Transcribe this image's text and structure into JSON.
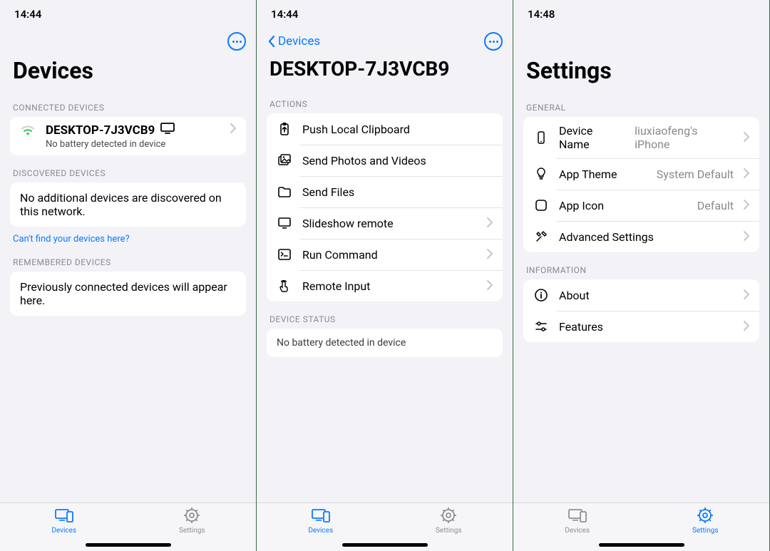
{
  "screen1": {
    "time": "14:44",
    "title": "Devices",
    "sections": {
      "connected_header": "CONNECTED DEVICES",
      "device_name": "DESKTOP-7J3VCB9",
      "device_sub": "No battery detected in device",
      "discovered_header": "DISCOVERED DEVICES",
      "discovered_text": "No additional devices are discovered on this network.",
      "discovered_link": "Can't find your devices here?",
      "remembered_header": "REMEMBERED DEVICES",
      "remembered_text": "Previously connected devices will appear here."
    },
    "tabs": {
      "devices": "Devices",
      "settings": "Settings",
      "active": "devices"
    }
  },
  "screen2": {
    "time": "14:44",
    "back_label": "Devices",
    "title": "DESKTOP-7J3VCB9",
    "actions_header": "ACTIONS",
    "actions": [
      {
        "id": "push-clipboard",
        "label": "Push Local Clipboard",
        "chevron": false
      },
      {
        "id": "send-photos",
        "label": "Send Photos and Videos",
        "chevron": false
      },
      {
        "id": "send-files",
        "label": "Send Files",
        "chevron": false
      },
      {
        "id": "slideshow-remote",
        "label": "Slideshow remote",
        "chevron": true
      },
      {
        "id": "run-command",
        "label": "Run Command",
        "chevron": true
      },
      {
        "id": "remote-input",
        "label": "Remote Input",
        "chevron": true
      }
    ],
    "status_header": "DEVICE STATUS",
    "status_text": "No battery detected in device",
    "tabs": {
      "devices": "Devices",
      "settings": "Settings",
      "active": "devices"
    }
  },
  "screen3": {
    "time": "14:48",
    "title": "Settings",
    "general_header": "GENERAL",
    "general": [
      {
        "id": "device-name",
        "label": "Device Name",
        "detail": "liuxiaofeng's iPhone"
      },
      {
        "id": "app-theme",
        "label": "App Theme",
        "detail": "System Default"
      },
      {
        "id": "app-icon",
        "label": "App Icon",
        "detail": "Default"
      },
      {
        "id": "advanced",
        "label": "Advanced Settings",
        "detail": ""
      }
    ],
    "info_header": "INFORMATION",
    "info": [
      {
        "id": "about",
        "label": "About"
      },
      {
        "id": "features",
        "label": "Features"
      }
    ],
    "tabs": {
      "devices": "Devices",
      "settings": "Settings",
      "active": "settings"
    }
  }
}
